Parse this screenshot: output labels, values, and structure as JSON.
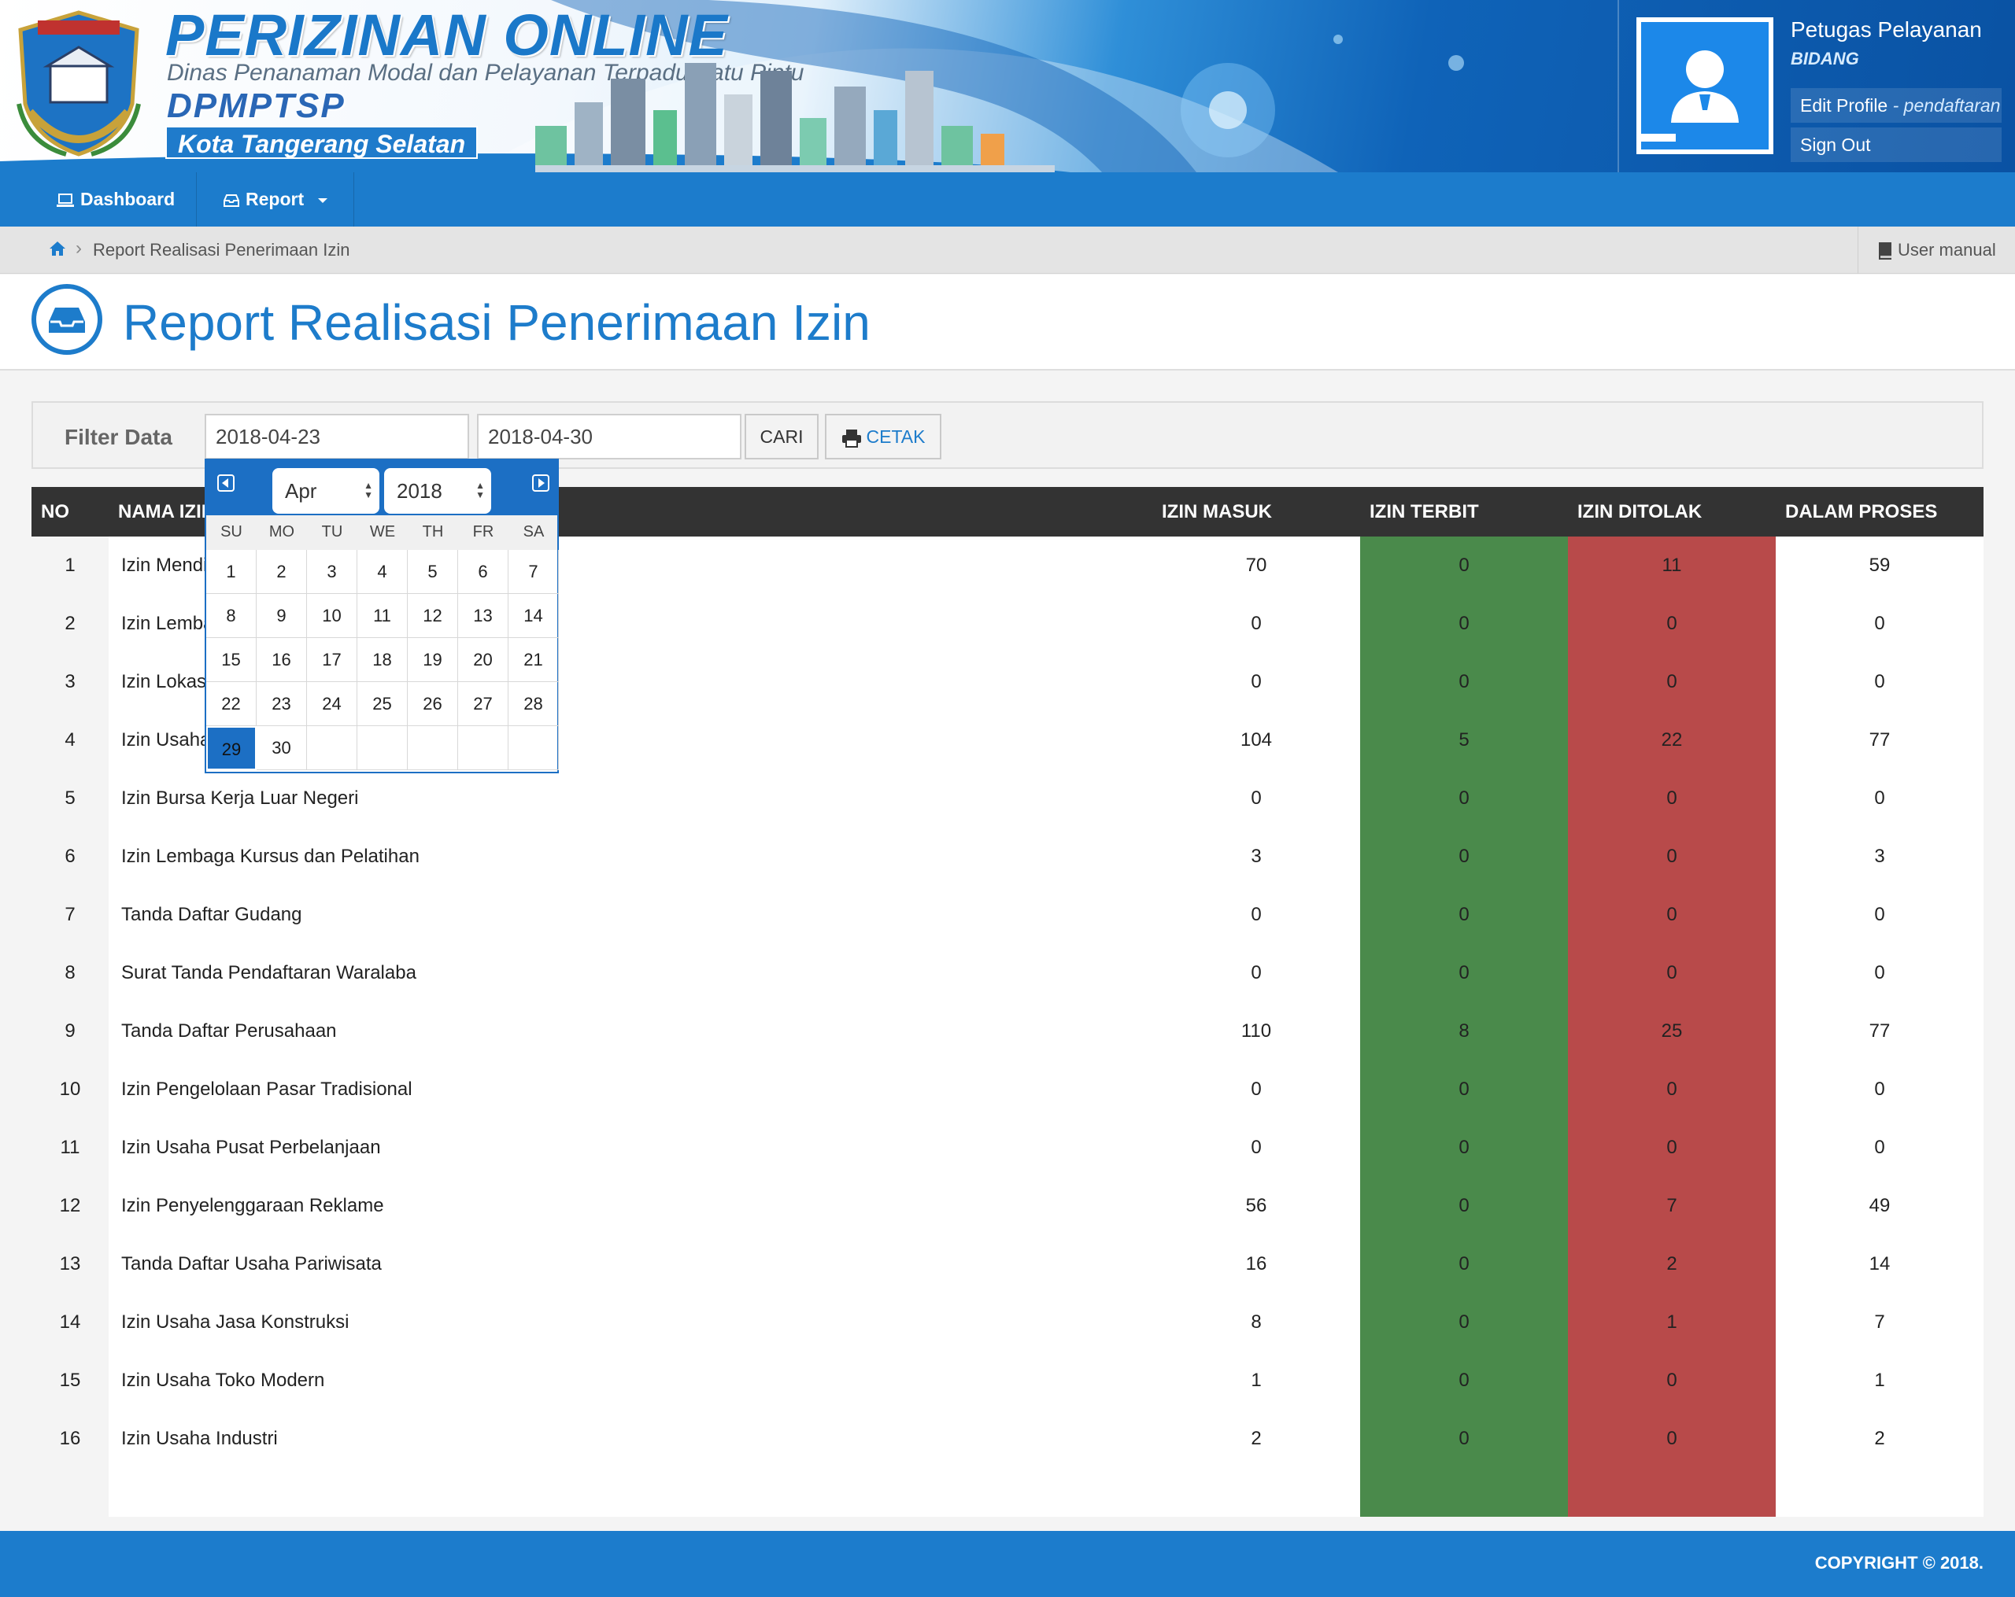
{
  "header": {
    "brand_title": "PERIZINAN ONLINE",
    "brand_subtitle": "Dinas Penanaman Modal dan Pelayanan Terpadu Satu Pintu",
    "brand_short": "DPMPTSP",
    "brand_city": "Kota Tangerang Selatan",
    "user_name": "Petugas Pelayanan",
    "user_role": "BIDANG",
    "edit_profile_label": "Edit Profile",
    "edit_profile_user": " - pendaftaran",
    "sign_out_label": "Sign Out"
  },
  "nav": {
    "dashboard_label": "Dashboard",
    "report_label": "Report"
  },
  "breadcrumb": {
    "current": "Report Realisasi Penerimaan Izin",
    "user_manual": "User manual"
  },
  "page": {
    "title": "Report Realisasi Penerimaan Izin"
  },
  "filter": {
    "label": "Filter Data",
    "date_from": "2018-04-23",
    "date_to": "2018-04-30",
    "search_button": "CARI",
    "print_button": "CETAK"
  },
  "calendar": {
    "month": "Apr",
    "year": "2018",
    "weekdays": [
      "SU",
      "MO",
      "TU",
      "WE",
      "TH",
      "FR",
      "SA"
    ],
    "weeks": [
      [
        "1",
        "2",
        "3",
        "4",
        "5",
        "6",
        "7"
      ],
      [
        "8",
        "9",
        "10",
        "11",
        "12",
        "13",
        "14"
      ],
      [
        "15",
        "16",
        "17",
        "18",
        "19",
        "20",
        "21"
      ],
      [
        "22",
        "23",
        "24",
        "25",
        "26",
        "27",
        "28"
      ],
      [
        "29",
        "30",
        "",
        "",
        "",
        "",
        ""
      ]
    ],
    "selected_day": "29"
  },
  "table": {
    "headers": {
      "no": "NO",
      "name": "NAMA IZIN",
      "masuk": "IZIN MASUK",
      "terbit": "IZIN TERBIT",
      "ditolak": "IZIN DITOLAK",
      "proses": "DALAM PROSES"
    },
    "rows": [
      {
        "no": "1",
        "name": "Izin Mendirikan Bangunan",
        "masuk": "70",
        "terbit": "0",
        "ditolak": "11",
        "proses": "59"
      },
      {
        "no": "2",
        "name": "Izin Lembaga",
        "masuk": "0",
        "terbit": "0",
        "ditolak": "0",
        "proses": "0"
      },
      {
        "no": "3",
        "name": "Izin Lokasi",
        "masuk": "0",
        "terbit": "0",
        "ditolak": "0",
        "proses": "0"
      },
      {
        "no": "4",
        "name": "Izin Usaha",
        "masuk": "104",
        "terbit": "5",
        "ditolak": "22",
        "proses": "77"
      },
      {
        "no": "5",
        "name": "Izin Bursa Kerja Luar Negeri",
        "masuk": "0",
        "terbit": "0",
        "ditolak": "0",
        "proses": "0"
      },
      {
        "no": "6",
        "name": "Izin Lembaga Kursus dan Pelatihan",
        "masuk": "3",
        "terbit": "0",
        "ditolak": "0",
        "proses": "3"
      },
      {
        "no": "7",
        "name": "Tanda Daftar Gudang",
        "masuk": "0",
        "terbit": "0",
        "ditolak": "0",
        "proses": "0"
      },
      {
        "no": "8",
        "name": "Surat Tanda Pendaftaran Waralaba",
        "masuk": "0",
        "terbit": "0",
        "ditolak": "0",
        "proses": "0"
      },
      {
        "no": "9",
        "name": "Tanda Daftar Perusahaan",
        "masuk": "110",
        "terbit": "8",
        "ditolak": "25",
        "proses": "77"
      },
      {
        "no": "10",
        "name": "Izin Pengelolaan Pasar Tradisional",
        "masuk": "0",
        "terbit": "0",
        "ditolak": "0",
        "proses": "0"
      },
      {
        "no": "11",
        "name": "Izin Usaha Pusat Perbelanjaan",
        "masuk": "0",
        "terbit": "0",
        "ditolak": "0",
        "proses": "0"
      },
      {
        "no": "12",
        "name": "Izin Penyelenggaraan Reklame",
        "masuk": "56",
        "terbit": "0",
        "ditolak": "7",
        "proses": "49"
      },
      {
        "no": "13",
        "name": "Tanda Daftar Usaha Pariwisata",
        "masuk": "16",
        "terbit": "0",
        "ditolak": "2",
        "proses": "14"
      },
      {
        "no": "14",
        "name": "Izin Usaha Jasa Konstruksi",
        "masuk": "8",
        "terbit": "0",
        "ditolak": "1",
        "proses": "7"
      },
      {
        "no": "15",
        "name": "Izin Usaha Toko Modern",
        "masuk": "1",
        "terbit": "0",
        "ditolak": "0",
        "proses": "1"
      },
      {
        "no": "16",
        "name": "Izin Usaha Industri",
        "masuk": "2",
        "terbit": "0",
        "ditolak": "0",
        "proses": "2"
      }
    ]
  },
  "footer": {
    "copyright": "COPYRIGHT © 2018."
  },
  "colors": {
    "primary": "#1c7ccc",
    "terbit": "#4a8a4b",
    "ditolak": "#b84a4a",
    "table_header": "#333333"
  },
  "icons": [
    "logo-emblem",
    "laptop-icon",
    "inbox-icon",
    "caret-down-icon",
    "home-icon",
    "chevron-right-icon",
    "book-icon",
    "print-icon",
    "prev-month-icon",
    "next-month-icon",
    "user-icon"
  ]
}
